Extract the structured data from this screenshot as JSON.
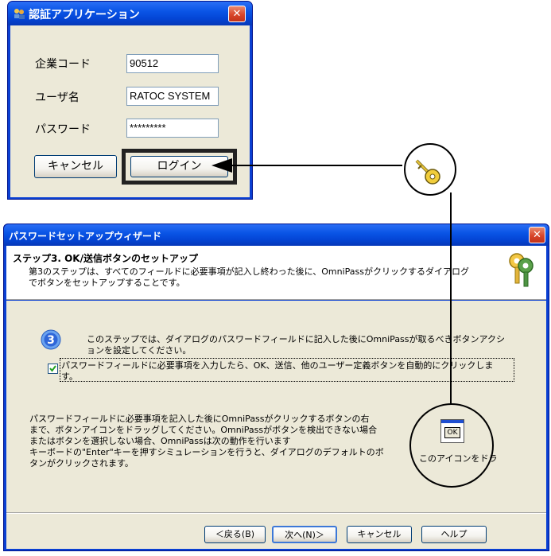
{
  "login": {
    "title": "認証アプリケーション",
    "close": "✕",
    "company_label": "企業コード",
    "company_value": "90512",
    "user_label": "ユーザ名",
    "user_value": "RATOC SYSTEM",
    "password_label": "パスワード",
    "password_value": "*********",
    "cancel": "キャンセル",
    "login": "ログイン"
  },
  "wizard": {
    "title": "パスワードセットアップウィザード",
    "close": "✕",
    "step_title": "ステップ3.  OK/送信ボタンのセットアップ",
    "step_desc_1": "第3のステップは、すべてのフィールドに必要事項が記入し終わった後に、OmniPassがクリックするダイアログ",
    "step_desc_2": "でボタンをセットアップすることです。",
    "step_number": "3",
    "intro_1": "このステップでは、ダイアログのパスワードフィールドに記入した後にOmniPassが取るべきボタンアクシ",
    "intro_2": "ョンを設定してください。",
    "checkbox_label_1": "パスワードフィールドに必要事項を入力したら、OK、送信、他のユーザー定義ボタンを自動的にクリックしま",
    "checkbox_label_2": "す。",
    "checkbox_checked": true,
    "info_1": "パスワードフィールドに必要事項を記入した後にOmniPassがクリックするボタンの右",
    "info_2": "まで、ボタンアイコンをドラッグしてください。OmniPassがボタンを検出できない場合",
    "info_3": "またはボタンを選択しない場合、OmniPassは次の動作を行います",
    "info_4": "キーボードの\"Enter\"キーを押すシミュレーションを行うと、ダイアログのデフォルトのボ",
    "info_5": "タンがクリックされます。",
    "drag_icon_text": "OK",
    "drag_caption": "このアイコンをドラ",
    "back": "＜戻る(B)",
    "next": "次へ(N)＞",
    "cancel": "キャンセル",
    "help": "ヘルプ"
  },
  "colors": {
    "title_blue": "#0a55e6",
    "dialog_bg": "#ece9d8",
    "close_red": "#d8452a"
  },
  "icons": {
    "app": "app-icon",
    "key": "key-cursor-icon",
    "wizard_keys": "keys-icon",
    "step": "step-3-icon"
  }
}
